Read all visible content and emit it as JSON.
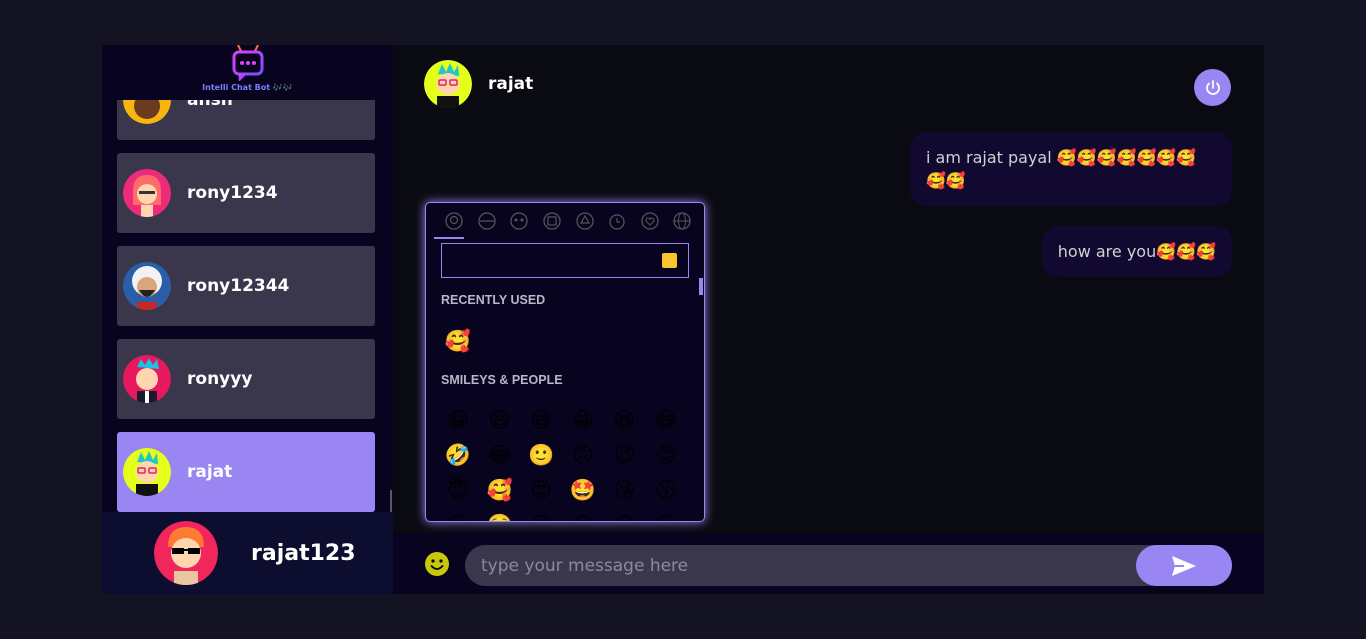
{
  "brand": {
    "title": "Intelli Chat Bot 🎶🎶"
  },
  "contacts": [
    {
      "name": "ansh"
    },
    {
      "name": "rony1234"
    },
    {
      "name": "rony12344"
    },
    {
      "name": "ronyyy"
    },
    {
      "name": "rajat",
      "selected": true
    }
  ],
  "current_user": {
    "name": "rajat123"
  },
  "chat": {
    "header_name": "rajat",
    "messages": [
      {
        "text": "i am rajat payal 🥰🥰🥰🥰🥰🥰🥰🥰🥰"
      },
      {
        "text": "how are you🥰🥰🥰"
      }
    ],
    "input": {
      "placeholder": "type your message here",
      "value": ""
    }
  },
  "emoji_picker": {
    "categories": [
      "smileys-people",
      "animals-nature",
      "food-drink",
      "activity",
      "travel-places",
      "objects",
      "symbols",
      "flags"
    ],
    "search_value": "",
    "sections": [
      {
        "title": "RECENTLY USED",
        "emojis": [
          "🥰"
        ]
      },
      {
        "title": "SMILEYS & PEOPLE",
        "emojis": [
          "😀",
          "😃",
          "😄",
          "😁",
          "😆",
          "😅",
          "🤣",
          "😂",
          "🙂",
          "🙃",
          "😉",
          "😊",
          "😇",
          "🥰",
          "😍",
          "🤩",
          "😘",
          "😗",
          "😚",
          "☺️",
          "😙",
          "😋",
          "😛",
          "😜"
        ]
      }
    ]
  },
  "colors": {
    "accent": "#9a86f3",
    "background": "#131324",
    "panel": "#080420",
    "swatch": "#f7c62f"
  }
}
